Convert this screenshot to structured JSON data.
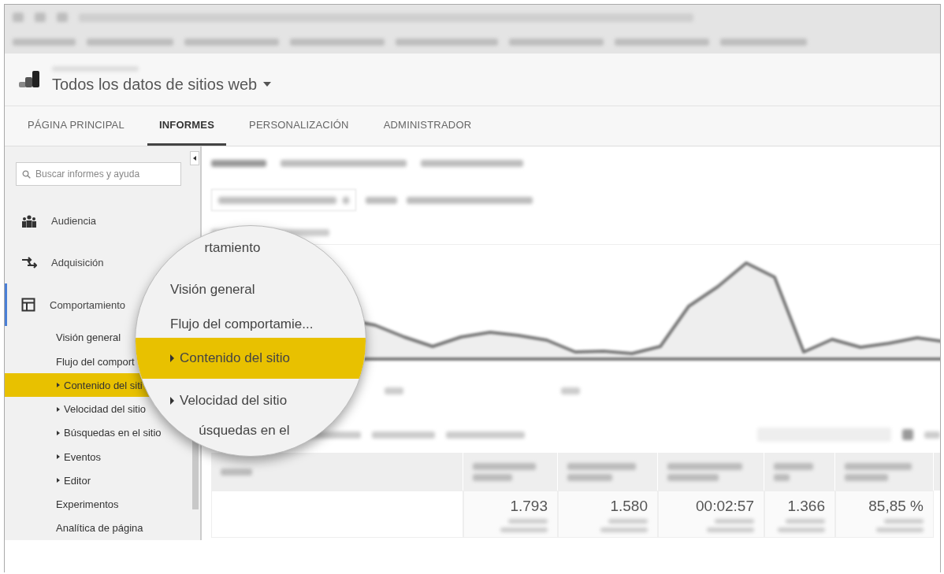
{
  "header": {
    "title": "Todos los datos de sitios web"
  },
  "nav_tabs": [
    {
      "label": "PÁGINA PRINCIPAL",
      "selected": false
    },
    {
      "label": "INFORMES",
      "selected": true
    },
    {
      "label": "PERSONALIZACIÓN",
      "selected": false
    },
    {
      "label": "ADMINISTRADOR",
      "selected": false
    }
  ],
  "sidebar": {
    "search": {
      "placeholder": "Buscar informes y ayuda"
    },
    "items": [
      {
        "label": "Audiencia",
        "selected": false
      },
      {
        "label": "Adquisición",
        "selected": false
      },
      {
        "label": "Comportamiento",
        "selected": true,
        "children": [
          {
            "label": "Visión general",
            "kind": "report",
            "selected": false
          },
          {
            "label": "Flujo del comport",
            "kind": "report",
            "selected": false
          },
          {
            "label": "Contenido del siti",
            "kind": "folder",
            "selected": true
          },
          {
            "label": "Velocidad del sitio",
            "kind": "folder",
            "selected": false
          },
          {
            "label": "Búsquedas en el sitio",
            "kind": "folder",
            "selected": false
          },
          {
            "label": "Eventos",
            "kind": "folder",
            "selected": false
          },
          {
            "label": "Editor",
            "kind": "folder",
            "selected": false
          },
          {
            "label": "Experimentos",
            "kind": "report",
            "selected": false
          },
          {
            "label": "Analítica de página",
            "kind": "report",
            "selected": false
          }
        ]
      }
    ]
  },
  "magnifier": {
    "items": [
      {
        "label": "rtamiento",
        "kind": "report",
        "selected": false
      },
      {
        "label": "Visión general",
        "kind": "report",
        "selected": false
      },
      {
        "label": "Flujo del comportamie...",
        "kind": "report",
        "selected": false
      },
      {
        "label": "Contenido del sitio",
        "kind": "folder",
        "selected": true
      },
      {
        "label": "Velocidad del sitio",
        "kind": "folder",
        "selected": false
      },
      {
        "label": "úsquedas en el",
        "kind": "report",
        "selected": false
      }
    ]
  },
  "table": {
    "values": [
      "1.793",
      "1.580",
      "00:02:57",
      "1.366",
      "85,85 %"
    ]
  }
}
